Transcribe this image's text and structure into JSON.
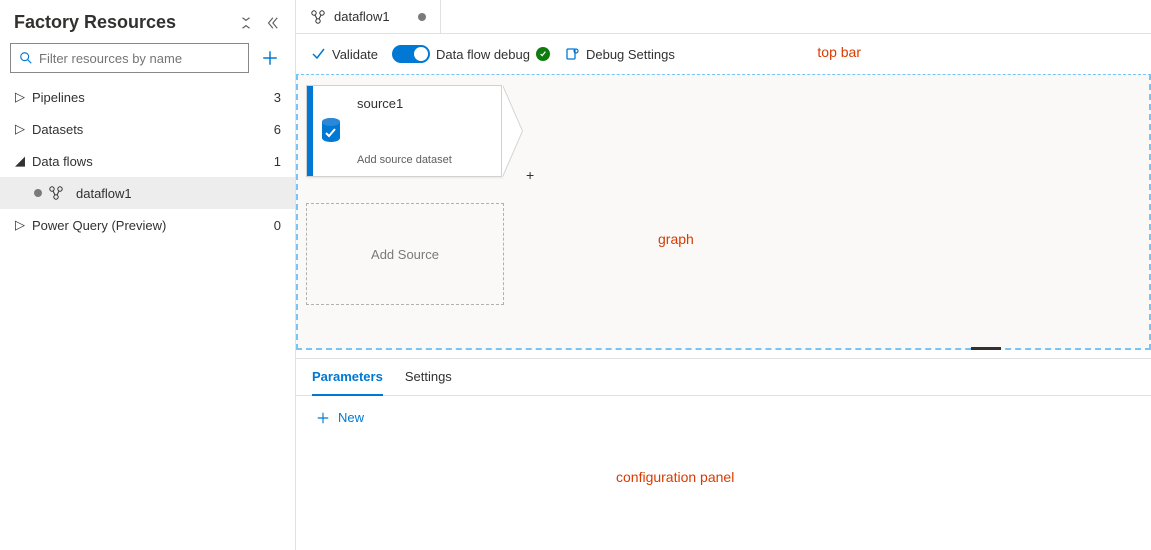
{
  "sidebar": {
    "title": "Factory Resources",
    "search_placeholder": "Filter resources by name",
    "items": [
      {
        "label": "Pipelines",
        "count": "3",
        "expanded": false
      },
      {
        "label": "Datasets",
        "count": "6",
        "expanded": false
      },
      {
        "label": "Data flows",
        "count": "1",
        "expanded": true,
        "children": [
          {
            "label": "dataflow1",
            "dirty": true
          }
        ]
      },
      {
        "label": "Power Query (Preview)",
        "count": "0",
        "expanded": false
      }
    ]
  },
  "tab": {
    "label": "dataflow1"
  },
  "topbar": {
    "validate": "Validate",
    "debug_label": "Data flow debug",
    "debug_settings": "Debug Settings"
  },
  "graph": {
    "source_node": {
      "title": "source1",
      "subtitle": "Add source dataset"
    },
    "add_source": "Add Source"
  },
  "config": {
    "tabs": [
      "Parameters",
      "Settings"
    ],
    "active_tab": "Parameters",
    "new_label": "New"
  },
  "annotations": {
    "topbar": "top bar",
    "graph": "graph",
    "config": "configuration panel"
  },
  "colors": {
    "accent": "#0078d4",
    "annot": "#d83b01",
    "success": "#107c10"
  }
}
